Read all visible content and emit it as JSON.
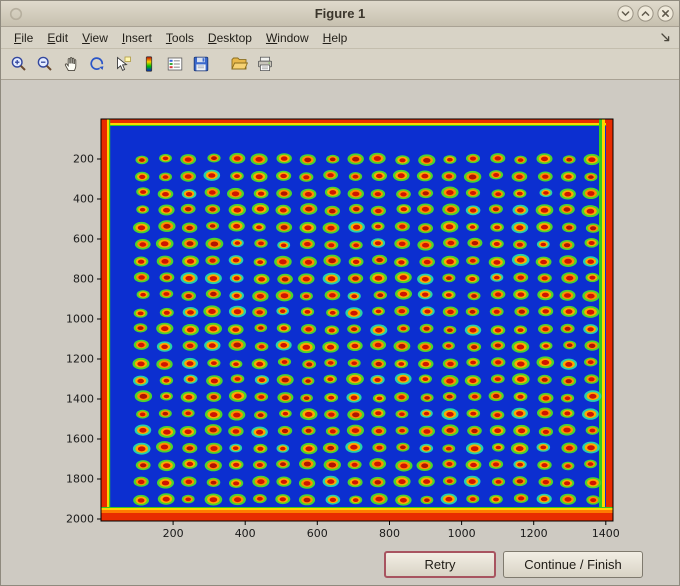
{
  "window": {
    "title": "Figure 1",
    "controls": [
      "collapse",
      "expand",
      "close"
    ]
  },
  "menu_bar": {
    "items": [
      "File",
      "Edit",
      "View",
      "Insert",
      "Tools",
      "Desktop",
      "Window",
      "Help"
    ],
    "corner_icon": "dock-figure"
  },
  "toolbar": {
    "icons": [
      "zoom-in",
      "zoom-out",
      "pan",
      "rotate-3d",
      "data-cursor",
      "insert-colorbar",
      "insert-legend",
      "save-figure",
      "open-file",
      "print-figure"
    ]
  },
  "footer": {
    "retry_label": "Retry",
    "continue_label": "Continue / Finish"
  },
  "chart_data": {
    "type": "heatmap",
    "title": "",
    "xlabel": "",
    "ylabel": "",
    "x_ticks": [
      200,
      400,
      600,
      800,
      1000,
      1200,
      1400
    ],
    "y_ticks": [
      200,
      400,
      600,
      800,
      1000,
      1200,
      1400,
      1600,
      1800,
      2000
    ],
    "x_range": [
      0,
      1420
    ],
    "y_range": [
      0,
      2010
    ],
    "grid": {
      "cols": 20,
      "rows": 21
    },
    "description": "Pseudocolor (jet colormap) image of a sample plate: a regular 20 x 21 grid of warm spots (red cores with orange halos and green rims) on a blue background, with saturated red/orange edges around the plate border.",
    "colors": {
      "field": "#0c2fd0",
      "edge": "#e82c00",
      "edge_orange": "#ff7a00",
      "edge_inner": "#ffd400",
      "edge_green": "#33cc22",
      "spot_ring": "#4cd42c",
      "spot_ring_alt": "#27d2a8",
      "spot_mid": "#ffa800",
      "spot_core": "#d01400"
    }
  }
}
